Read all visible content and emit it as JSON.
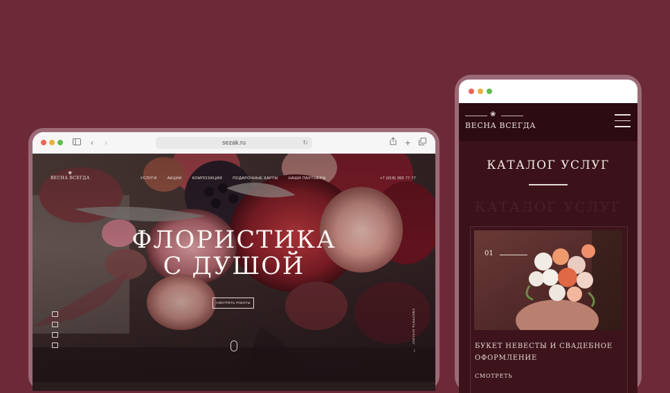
{
  "desktop": {
    "url": "sezak.ru",
    "site": {
      "logo": "ВЕСНА ВСЕГДА",
      "nav": [
        "УСЛУГИ",
        "АКЦИИ",
        "КОМПОЗИЦИИ",
        "ПОДАРОЧНЫЕ КАРТЫ",
        "НАШИ ПАРТНЕРЫ"
      ],
      "phone": "+7 (918) 392 77 77",
      "hero_title_line1": "ФЛОРИСТИКА",
      "hero_title_line2": "С ДУШОЙ",
      "cta": "СМОТРЕТЬ РАБОТЫ",
      "side_label": "СМОТРЕТЬ КАТАЛОГ"
    }
  },
  "mobile": {
    "logo": "ВЕСНА ВСЕГДА",
    "title": "КАТАЛОГ УСЛУГ",
    "ghost_title": "КАТАЛОГ УСЛУГ",
    "card": {
      "number": "01",
      "name": "БУКЕТ НЕВЕСТЫ И СВАДЕБНОЕ ОФОРМЛЕНИЕ",
      "more": "СМОТРЕТЬ"
    }
  },
  "colors": {
    "background": "#6c2a38",
    "device_frame": "#9c6a77",
    "mobile_header": "#2c0b12",
    "mobile_body": "#3b121a"
  },
  "icons": [
    "sidebar-icon",
    "back-icon",
    "forward-icon",
    "reload-icon",
    "share-icon",
    "new-tab-icon",
    "tabs-icon",
    "menu-icon",
    "lotus-logo-icon",
    "mouse-scroll-icon"
  ]
}
